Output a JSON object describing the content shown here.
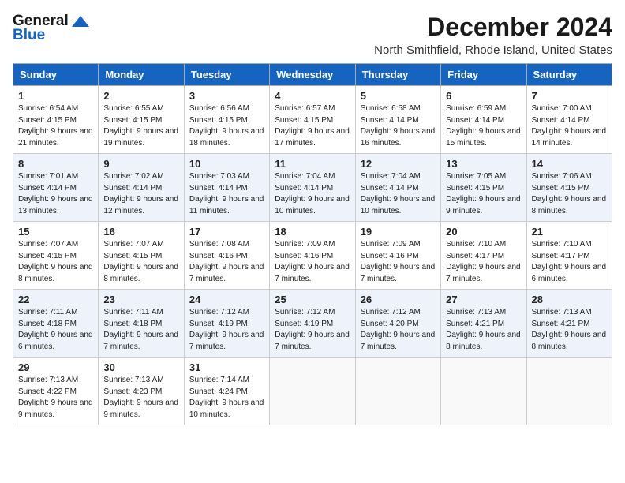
{
  "logo": {
    "line1": "General",
    "line2": "Blue"
  },
  "title": "December 2024",
  "location": "North Smithfield, Rhode Island, United States",
  "weekdays": [
    "Sunday",
    "Monday",
    "Tuesday",
    "Wednesday",
    "Thursday",
    "Friday",
    "Saturday"
  ],
  "weeks": [
    [
      {
        "day": "1",
        "sunrise": "Sunrise: 6:54 AM",
        "sunset": "Sunset: 4:15 PM",
        "daylight": "Daylight: 9 hours and 21 minutes."
      },
      {
        "day": "2",
        "sunrise": "Sunrise: 6:55 AM",
        "sunset": "Sunset: 4:15 PM",
        "daylight": "Daylight: 9 hours and 19 minutes."
      },
      {
        "day": "3",
        "sunrise": "Sunrise: 6:56 AM",
        "sunset": "Sunset: 4:15 PM",
        "daylight": "Daylight: 9 hours and 18 minutes."
      },
      {
        "day": "4",
        "sunrise": "Sunrise: 6:57 AM",
        "sunset": "Sunset: 4:15 PM",
        "daylight": "Daylight: 9 hours and 17 minutes."
      },
      {
        "day": "5",
        "sunrise": "Sunrise: 6:58 AM",
        "sunset": "Sunset: 4:14 PM",
        "daylight": "Daylight: 9 hours and 16 minutes."
      },
      {
        "day": "6",
        "sunrise": "Sunrise: 6:59 AM",
        "sunset": "Sunset: 4:14 PM",
        "daylight": "Daylight: 9 hours and 15 minutes."
      },
      {
        "day": "7",
        "sunrise": "Sunrise: 7:00 AM",
        "sunset": "Sunset: 4:14 PM",
        "daylight": "Daylight: 9 hours and 14 minutes."
      }
    ],
    [
      {
        "day": "8",
        "sunrise": "Sunrise: 7:01 AM",
        "sunset": "Sunset: 4:14 PM",
        "daylight": "Daylight: 9 hours and 13 minutes."
      },
      {
        "day": "9",
        "sunrise": "Sunrise: 7:02 AM",
        "sunset": "Sunset: 4:14 PM",
        "daylight": "Daylight: 9 hours and 12 minutes."
      },
      {
        "day": "10",
        "sunrise": "Sunrise: 7:03 AM",
        "sunset": "Sunset: 4:14 PM",
        "daylight": "Daylight: 9 hours and 11 minutes."
      },
      {
        "day": "11",
        "sunrise": "Sunrise: 7:04 AM",
        "sunset": "Sunset: 4:14 PM",
        "daylight": "Daylight: 9 hours and 10 minutes."
      },
      {
        "day": "12",
        "sunrise": "Sunrise: 7:04 AM",
        "sunset": "Sunset: 4:14 PM",
        "daylight": "Daylight: 9 hours and 10 minutes."
      },
      {
        "day": "13",
        "sunrise": "Sunrise: 7:05 AM",
        "sunset": "Sunset: 4:15 PM",
        "daylight": "Daylight: 9 hours and 9 minutes."
      },
      {
        "day": "14",
        "sunrise": "Sunrise: 7:06 AM",
        "sunset": "Sunset: 4:15 PM",
        "daylight": "Daylight: 9 hours and 8 minutes."
      }
    ],
    [
      {
        "day": "15",
        "sunrise": "Sunrise: 7:07 AM",
        "sunset": "Sunset: 4:15 PM",
        "daylight": "Daylight: 9 hours and 8 minutes."
      },
      {
        "day": "16",
        "sunrise": "Sunrise: 7:07 AM",
        "sunset": "Sunset: 4:15 PM",
        "daylight": "Daylight: 9 hours and 8 minutes."
      },
      {
        "day": "17",
        "sunrise": "Sunrise: 7:08 AM",
        "sunset": "Sunset: 4:16 PM",
        "daylight": "Daylight: 9 hours and 7 minutes."
      },
      {
        "day": "18",
        "sunrise": "Sunrise: 7:09 AM",
        "sunset": "Sunset: 4:16 PM",
        "daylight": "Daylight: 9 hours and 7 minutes."
      },
      {
        "day": "19",
        "sunrise": "Sunrise: 7:09 AM",
        "sunset": "Sunset: 4:16 PM",
        "daylight": "Daylight: 9 hours and 7 minutes."
      },
      {
        "day": "20",
        "sunrise": "Sunrise: 7:10 AM",
        "sunset": "Sunset: 4:17 PM",
        "daylight": "Daylight: 9 hours and 7 minutes."
      },
      {
        "day": "21",
        "sunrise": "Sunrise: 7:10 AM",
        "sunset": "Sunset: 4:17 PM",
        "daylight": "Daylight: 9 hours and 6 minutes."
      }
    ],
    [
      {
        "day": "22",
        "sunrise": "Sunrise: 7:11 AM",
        "sunset": "Sunset: 4:18 PM",
        "daylight": "Daylight: 9 hours and 6 minutes."
      },
      {
        "day": "23",
        "sunrise": "Sunrise: 7:11 AM",
        "sunset": "Sunset: 4:18 PM",
        "daylight": "Daylight: 9 hours and 7 minutes."
      },
      {
        "day": "24",
        "sunrise": "Sunrise: 7:12 AM",
        "sunset": "Sunset: 4:19 PM",
        "daylight": "Daylight: 9 hours and 7 minutes."
      },
      {
        "day": "25",
        "sunrise": "Sunrise: 7:12 AM",
        "sunset": "Sunset: 4:19 PM",
        "daylight": "Daylight: 9 hours and 7 minutes."
      },
      {
        "day": "26",
        "sunrise": "Sunrise: 7:12 AM",
        "sunset": "Sunset: 4:20 PM",
        "daylight": "Daylight: 9 hours and 7 minutes."
      },
      {
        "day": "27",
        "sunrise": "Sunrise: 7:13 AM",
        "sunset": "Sunset: 4:21 PM",
        "daylight": "Daylight: 9 hours and 8 minutes."
      },
      {
        "day": "28",
        "sunrise": "Sunrise: 7:13 AM",
        "sunset": "Sunset: 4:21 PM",
        "daylight": "Daylight: 9 hours and 8 minutes."
      }
    ],
    [
      {
        "day": "29",
        "sunrise": "Sunrise: 7:13 AM",
        "sunset": "Sunset: 4:22 PM",
        "daylight": "Daylight: 9 hours and 9 minutes."
      },
      {
        "day": "30",
        "sunrise": "Sunrise: 7:13 AM",
        "sunset": "Sunset: 4:23 PM",
        "daylight": "Daylight: 9 hours and 9 minutes."
      },
      {
        "day": "31",
        "sunrise": "Sunrise: 7:14 AM",
        "sunset": "Sunset: 4:24 PM",
        "daylight": "Daylight: 9 hours and 10 minutes."
      },
      null,
      null,
      null,
      null
    ]
  ]
}
